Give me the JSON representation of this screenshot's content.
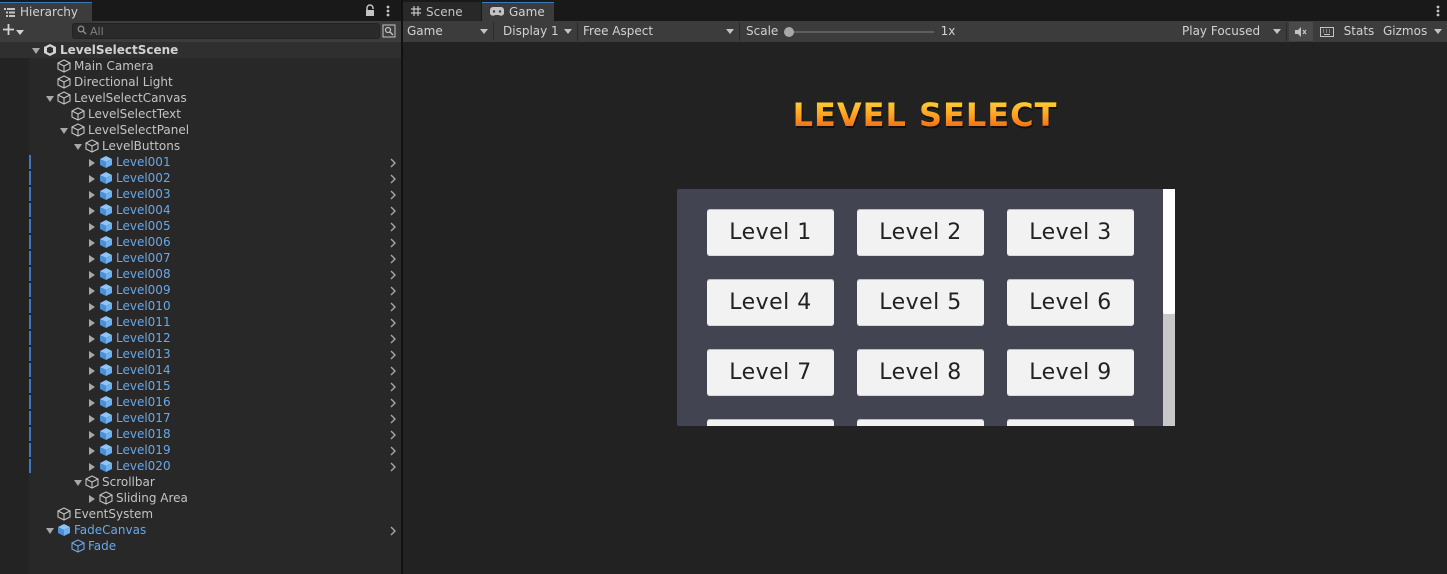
{
  "hierarchy": {
    "tab_label": "Hierarchy",
    "search_placeholder": "All",
    "rows": [
      {
        "name": "LevelSelectScene",
        "depth": 0,
        "arrow": "expanded",
        "icon": "unity-scene-icon",
        "style": "scene"
      },
      {
        "name": "Main Camera",
        "depth": 1,
        "arrow": "none",
        "icon": "gameobject-icon",
        "style": "normal"
      },
      {
        "name": "Directional Light",
        "depth": 1,
        "arrow": "none",
        "icon": "gameobject-icon",
        "style": "normal"
      },
      {
        "name": "LevelSelectCanvas",
        "depth": 1,
        "arrow": "expanded",
        "icon": "gameobject-icon",
        "style": "normal"
      },
      {
        "name": "LevelSelectText",
        "depth": 2,
        "arrow": "none",
        "icon": "gameobject-icon",
        "style": "normal"
      },
      {
        "name": "LevelSelectPanel",
        "depth": 2,
        "arrow": "expanded",
        "icon": "gameobject-icon",
        "style": "normal"
      },
      {
        "name": "LevelButtons",
        "depth": 3,
        "arrow": "expanded",
        "icon": "gameobject-icon",
        "style": "normal"
      },
      {
        "name": "Level001",
        "depth": 4,
        "arrow": "collapsed",
        "icon": "prefab-icon",
        "style": "prefab"
      },
      {
        "name": "Level002",
        "depth": 4,
        "arrow": "collapsed",
        "icon": "prefab-icon",
        "style": "prefab"
      },
      {
        "name": "Level003",
        "depth": 4,
        "arrow": "collapsed",
        "icon": "prefab-icon",
        "style": "prefab"
      },
      {
        "name": "Level004",
        "depth": 4,
        "arrow": "collapsed",
        "icon": "prefab-icon",
        "style": "prefab"
      },
      {
        "name": "Level005",
        "depth": 4,
        "arrow": "collapsed",
        "icon": "prefab-icon",
        "style": "prefab"
      },
      {
        "name": "Level006",
        "depth": 4,
        "arrow": "collapsed",
        "icon": "prefab-icon",
        "style": "prefab"
      },
      {
        "name": "Level007",
        "depth": 4,
        "arrow": "collapsed",
        "icon": "prefab-icon",
        "style": "prefab"
      },
      {
        "name": "Level008",
        "depth": 4,
        "arrow": "collapsed",
        "icon": "prefab-icon",
        "style": "prefab"
      },
      {
        "name": "Level009",
        "depth": 4,
        "arrow": "collapsed",
        "icon": "prefab-icon",
        "style": "prefab"
      },
      {
        "name": "Level010",
        "depth": 4,
        "arrow": "collapsed",
        "icon": "prefab-icon",
        "style": "prefab"
      },
      {
        "name": "Level011",
        "depth": 4,
        "arrow": "collapsed",
        "icon": "prefab-icon",
        "style": "prefab"
      },
      {
        "name": "Level012",
        "depth": 4,
        "arrow": "collapsed",
        "icon": "prefab-icon",
        "style": "prefab"
      },
      {
        "name": "Level013",
        "depth": 4,
        "arrow": "collapsed",
        "icon": "prefab-icon",
        "style": "prefab"
      },
      {
        "name": "Level014",
        "depth": 4,
        "arrow": "collapsed",
        "icon": "prefab-icon",
        "style": "prefab"
      },
      {
        "name": "Level015",
        "depth": 4,
        "arrow": "collapsed",
        "icon": "prefab-icon",
        "style": "prefab"
      },
      {
        "name": "Level016",
        "depth": 4,
        "arrow": "collapsed",
        "icon": "prefab-icon",
        "style": "prefab"
      },
      {
        "name": "Level017",
        "depth": 4,
        "arrow": "collapsed",
        "icon": "prefab-icon",
        "style": "prefab"
      },
      {
        "name": "Level018",
        "depth": 4,
        "arrow": "collapsed",
        "icon": "prefab-icon",
        "style": "prefab"
      },
      {
        "name": "Level019",
        "depth": 4,
        "arrow": "collapsed",
        "icon": "prefab-icon",
        "style": "prefab"
      },
      {
        "name": "Level020",
        "depth": 4,
        "arrow": "collapsed",
        "icon": "prefab-icon",
        "style": "prefab"
      },
      {
        "name": "Scrollbar",
        "depth": 3,
        "arrow": "expanded",
        "icon": "gameobject-icon",
        "style": "normal"
      },
      {
        "name": "Sliding Area",
        "depth": 4,
        "arrow": "collapsed",
        "icon": "gameobject-icon",
        "style": "normal"
      },
      {
        "name": "EventSystem",
        "depth": 1,
        "arrow": "none",
        "icon": "gameobject-icon",
        "style": "normal"
      },
      {
        "name": "FadeCanvas",
        "depth": 1,
        "arrow": "expanded",
        "icon": "prefab-icon",
        "style": "prefab-root"
      },
      {
        "name": "Fade",
        "depth": 2,
        "arrow": "none",
        "icon": "gameobject-icon",
        "style": "prefab-child"
      }
    ]
  },
  "view_tabs": {
    "scene_label": "Scene",
    "game_label": "Game"
  },
  "game_toolbar": {
    "mode": "Game",
    "display": "Display 1",
    "aspect": "Free Aspect",
    "scale_label": "Scale",
    "scale_value": "1x",
    "scale_fraction": 0.0,
    "play_mode": "Play Focused",
    "stats_label": "Stats",
    "gizmos_label": "Gizmos"
  },
  "game_view": {
    "title": "LEVEL SELECT",
    "buttons": [
      "Level 1",
      "Level 2",
      "Level 3",
      "Level 4",
      "Level 5",
      "Level 6",
      "Level 7",
      "Level 8",
      "Level 9",
      "",
      "",
      ""
    ]
  },
  "colors": {
    "selection_accent": "#3a79bb",
    "prefab_blue": "#6ba7e6",
    "panel_bg": "#434451",
    "title_gradient_top": "#ffe23a",
    "title_gradient_bottom": "#e8520e"
  }
}
